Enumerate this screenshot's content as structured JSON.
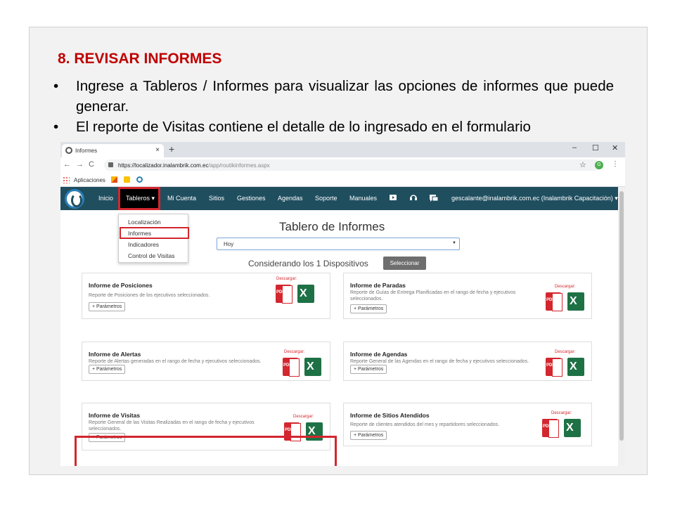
{
  "slide": {
    "title": "8. REVISAR INFORMES",
    "bullets": [
      "Ingrese a Tableros / Informes para visualizar las opciones de informes que puede generar.",
      "El reporte de Visitas contiene el detalle de lo ingresado en el formulario"
    ]
  },
  "browser": {
    "tab_title": "Informes",
    "tab_close": "×",
    "new_tab": "+",
    "window_controls": [
      "–",
      "☐",
      "✕"
    ],
    "nav": [
      "←",
      "→",
      "C"
    ],
    "url_host": "https://localizador.inalambrik.com.ec",
    "url_path": "/app/routikinformes.aspx",
    "star": "☆",
    "avatar_letter": "G",
    "menu_dots": "⋮",
    "bookmarks_label": "Aplicaciones"
  },
  "navbar": {
    "items": [
      "Inicio",
      "Tableros ▾",
      "Mi Cuenta",
      "Sitios",
      "Gestiones",
      "Agendas",
      "Soporte",
      "Manuales"
    ],
    "user": "gescalante@inalambrik.com.ec (Inalambrik Capacitación) ▾",
    "icons": [
      "video-icon",
      "headset-icon",
      "chat-icon"
    ]
  },
  "dropdown": {
    "items": [
      "Localización",
      "Informes",
      "Indicadores",
      "Control de Visitas"
    ]
  },
  "main": {
    "title": "Tablero de Informes",
    "select_value": "Hoy",
    "select_caret": "▼",
    "considering": "Considerando los 1 Dispositivos",
    "select_button": "Seleccionar"
  },
  "download_label": "Descargar:",
  "pdf_text": "PDF",
  "xls_text": "X",
  "param_label": "+ Parámetros",
  "cards": [
    {
      "title": "Informe de Posiciones",
      "desc": "Reporte de Posiciones de los ejecutivos seleccionados."
    },
    {
      "title": "Informe de Paradas",
      "desc": "Reporte de Guías de Entrega Planificadas en el rango de fecha y ejecutivos seleccionados."
    },
    {
      "title": "Informe de Alertas",
      "desc": "Reporte de Alertas generadas en el rango de fecha y ejecutivos seleccionados."
    },
    {
      "title": "Informe de Agendas",
      "desc": "Reporte General de las Agendas en el rango de fecha y ejecutivos seleccionados."
    },
    {
      "title": "Informe de Visitas",
      "desc": "Reporte General de las Visitas Realizadas en el rango de fecha y ejecutivos seleccionados."
    },
    {
      "title": "Informe de Sitios Atendidos",
      "desc": "Reporte de clientes atendidos del mes y repartidores seleccionados."
    }
  ],
  "colors": {
    "navbar": "#1f4e5f",
    "highlight": "#d3262e",
    "title_red": "#c00000"
  }
}
